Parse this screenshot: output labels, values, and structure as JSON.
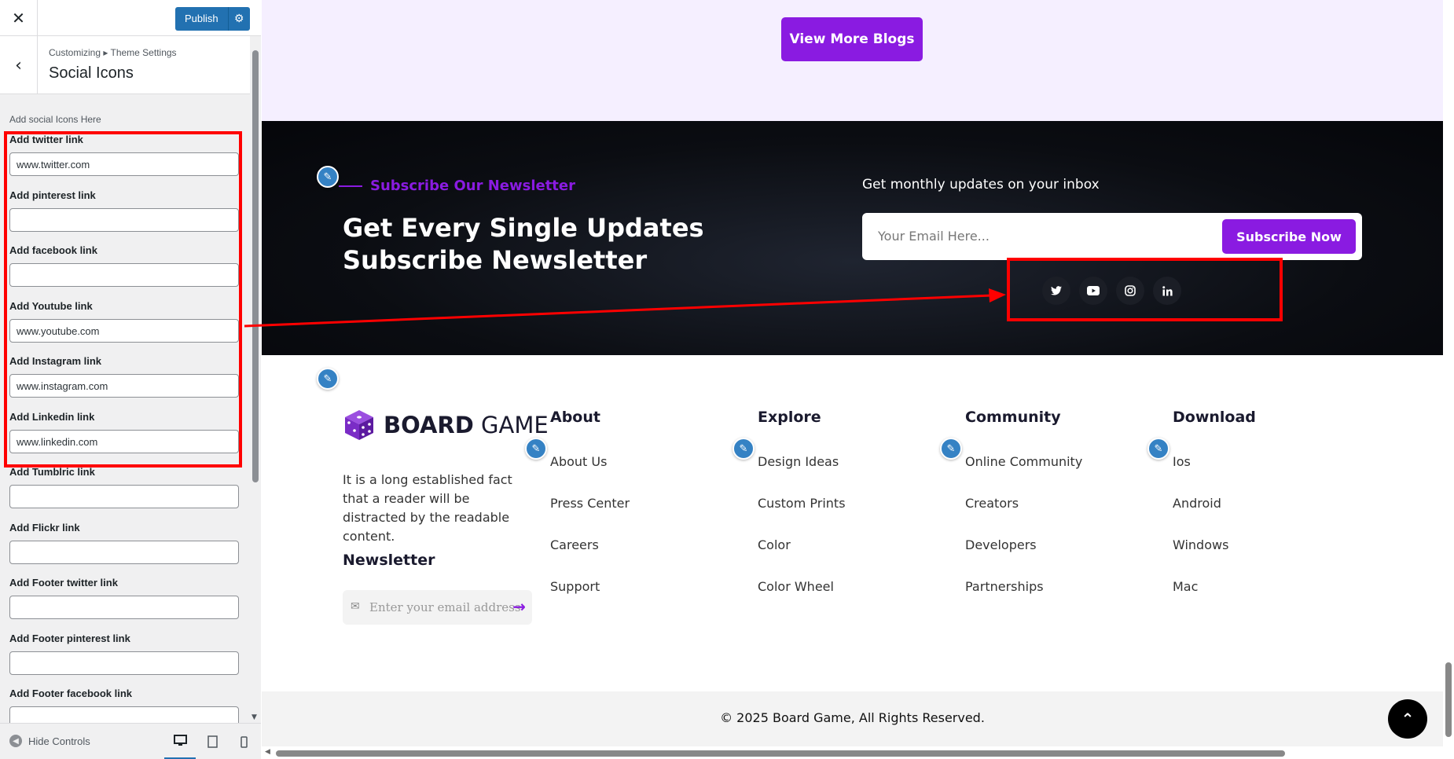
{
  "customizer": {
    "close_label": "✕",
    "publish_label": "Publish",
    "breadcrumb": "Customizing ▸ Theme Settings",
    "section_title": "Social Icons",
    "description": "Add social Icons Here",
    "controls": [
      {
        "label": "Add twitter link",
        "value": "www.twitter.com"
      },
      {
        "label": "Add pinterest link",
        "value": ""
      },
      {
        "label": "Add facebook link",
        "value": ""
      },
      {
        "label": "Add Youtube link",
        "value": "www.youtube.com"
      },
      {
        "label": "Add Instagram link",
        "value": "www.instagram.com"
      },
      {
        "label": "Add Linkedin link",
        "value": "www.linkedin.com"
      },
      {
        "label": "Add Tumblric link",
        "value": ""
      },
      {
        "label": "Add Flickr link",
        "value": ""
      },
      {
        "label": "Add Footer twitter link",
        "value": ""
      },
      {
        "label": "Add Footer pinterest link",
        "value": ""
      },
      {
        "label": "Add Footer facebook link",
        "value": ""
      }
    ],
    "hide_controls_label": "Hide Controls",
    "devices": [
      "desktop-icon",
      "tablet-icon",
      "mobile-icon"
    ]
  },
  "preview": {
    "view_more_label": "View More Blogs",
    "newsletter": {
      "subtitle": "Subscribe Our Newsletter",
      "heading_line1": "Get Every Single Updates",
      "heading_line2": "Subscribe Newsletter",
      "monthly_text": "Get monthly updates on your inbox",
      "email_placeholder": "Your Email Here...",
      "subscribe_label": "Subscribe Now",
      "social_icons": [
        "twitter-icon",
        "youtube-icon",
        "instagram-icon",
        "linkedin-icon"
      ]
    },
    "footer": {
      "brand_bold": "BOARD",
      "brand_light": "GAME",
      "about_text": "It is a long established fact that a reader will be distracted by the readable content.",
      "newsletter_title": "Newsletter",
      "newsletter_placeholder": "Enter your email address",
      "columns": [
        {
          "title": "About",
          "links": [
            "About Us",
            "Press Center",
            "Careers",
            "Support"
          ]
        },
        {
          "title": "Explore",
          "links": [
            "Design Ideas",
            "Custom Prints",
            "Color",
            "Color Wheel"
          ]
        },
        {
          "title": "Community",
          "links": [
            "Online Community",
            "Creators",
            "Developers",
            "Partnerships"
          ]
        },
        {
          "title": "Download",
          "links": [
            "Ios",
            "Android",
            "Windows",
            "Mac"
          ]
        }
      ],
      "copyright": "© 2025 Board Game, All Rights Reserved."
    }
  },
  "colors": {
    "accent": "#8a1be1",
    "wp_blue": "#2271b1",
    "annotation": "#ff0000"
  }
}
